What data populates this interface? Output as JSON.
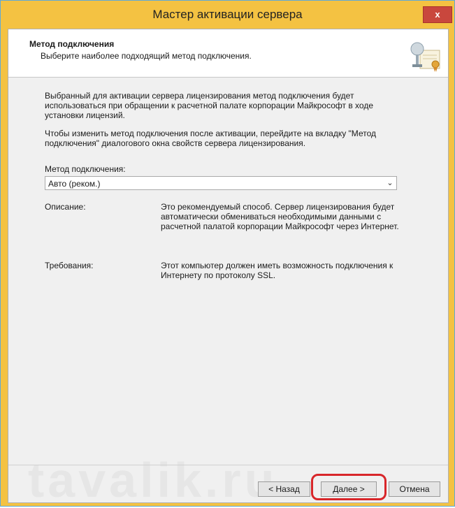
{
  "window": {
    "title": "Мастер активации сервера",
    "close_label": "x"
  },
  "header": {
    "title": "Метод подключения",
    "subtitle": "Выберите наиболее подходящий метод подключения.",
    "icon": "certificate-icon"
  },
  "body": {
    "paragraph1": "Выбранный для активации сервера лицензирования метод подключения будет использоваться при обращении к расчетной палате корпорации Майкрософт в ходе установки лицензий.",
    "paragraph2": "Чтобы изменить метод подключения после активации, перейдите на вкладку \"Метод подключения\" диалогового окна свойств сервера лицензирования.",
    "method_label": "Метод подключения:",
    "method_selected": "Авто (реком.)",
    "description_label": "Описание:",
    "description_text": "Это рекомендуемый способ. Сервер лицензирования будет автоматически обмениваться необходимыми данными с расчетной палатой корпорации Майкрософт через Интернет.",
    "requirements_label": "Требования:",
    "requirements_text": "Этот компьютер должен иметь возможность подключения к Интернету по протоколу SSL."
  },
  "buttons": {
    "back": "< Назад",
    "next": "Далее >",
    "cancel": "Отмена"
  },
  "watermark": "tavalik.ru",
  "colors": {
    "titlebar": "#f4c242",
    "highlight": "#d8262a"
  }
}
